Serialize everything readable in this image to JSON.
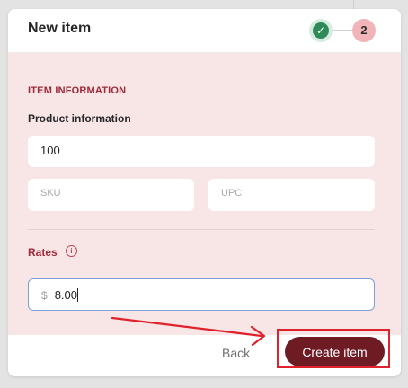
{
  "modal": {
    "title": "New item"
  },
  "stepper": {
    "step1_icon": "checkmark-icon",
    "step2_label": "2"
  },
  "form": {
    "section_title": "ITEM INFORMATION",
    "product_label": "Product information",
    "product_value": "100",
    "sku_placeholder": "SKU",
    "upc_placeholder": "UPC",
    "rates_label": "Rates",
    "rates_info_icon": "info-icon",
    "rate_currency": "$",
    "rate_value": "8.00"
  },
  "footer": {
    "back_label": "Back",
    "create_label": "Create item"
  },
  "annotation": {
    "arrow_color": "#e0202a",
    "highlight_color": "#e0202a"
  },
  "colors": {
    "accent": "#6e1b24",
    "section_title": "#a02a3a",
    "step_done": "#2e8b57",
    "step_current": "#f1b5b9",
    "body_background": "#f8e6e7"
  }
}
